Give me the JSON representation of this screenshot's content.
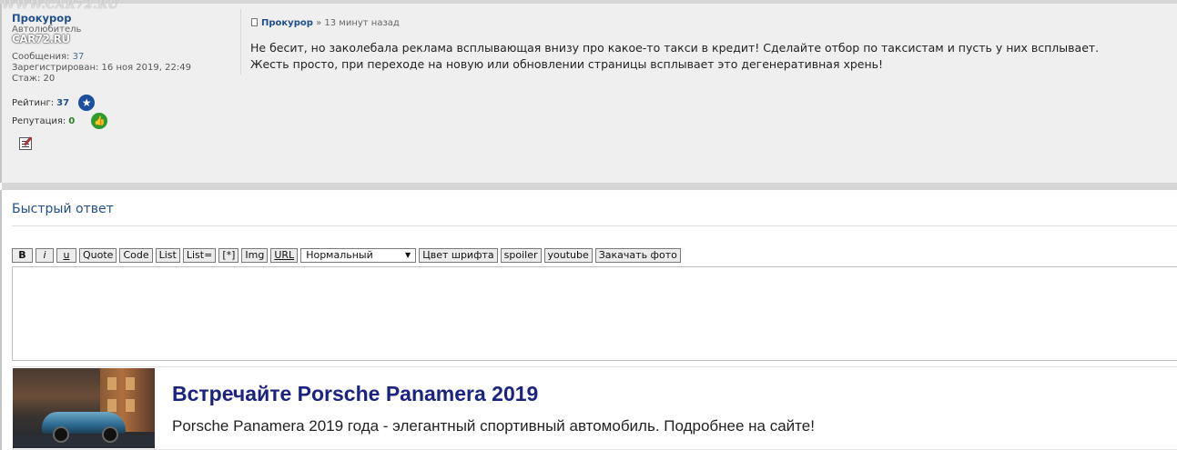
{
  "watermark": "WWW.CAR72.RU",
  "author": {
    "name": "Прокурор",
    "rank": "Автолюбитель",
    "logo": "CAR72.RU",
    "messages_label": "Сообщения:",
    "messages_value": "37",
    "registered_label": "Зарегистрирован:",
    "registered_value": "16 ноя 2019, 22:49",
    "tenure_label": "Стаж:",
    "tenure_value": "20",
    "rating_label": "Рейтинг:",
    "rating_value": "37",
    "reputation_label": "Репутация:",
    "reputation_value": "0"
  },
  "post": {
    "author_link": "Прокурор",
    "separator": "»",
    "time": "13 минут назад",
    "line1": "Не бесит, но заколебала реклама всплывающая внизу про какое-то такси в кредит! Сделайте отбор по таксистам и пусть у них всплывает.",
    "line2": "Жесть просто, при переходе на новую или обновлении страницы всплывает это дегенеративная хрень!"
  },
  "quick_reply": {
    "title": "Быстрый ответ",
    "toolbar": {
      "bold": "B",
      "italic": "i",
      "underline": "u",
      "quote": "Quote",
      "code": "Code",
      "list": "List",
      "list_eq": "List=",
      "item": "[*]",
      "img": "Img",
      "url": "URL",
      "size_select": "Нормальный",
      "font_color": "Цвет шрифта",
      "spoiler": "spoiler",
      "youtube": "youtube",
      "upload_photo": "Закачать фото"
    }
  },
  "ad": {
    "title": "Встречайте Porsche Panamera 2019",
    "text": "Porsche Panamera 2019 года - элегантный спортивный автомобиль. Подробнее на сайте!"
  }
}
